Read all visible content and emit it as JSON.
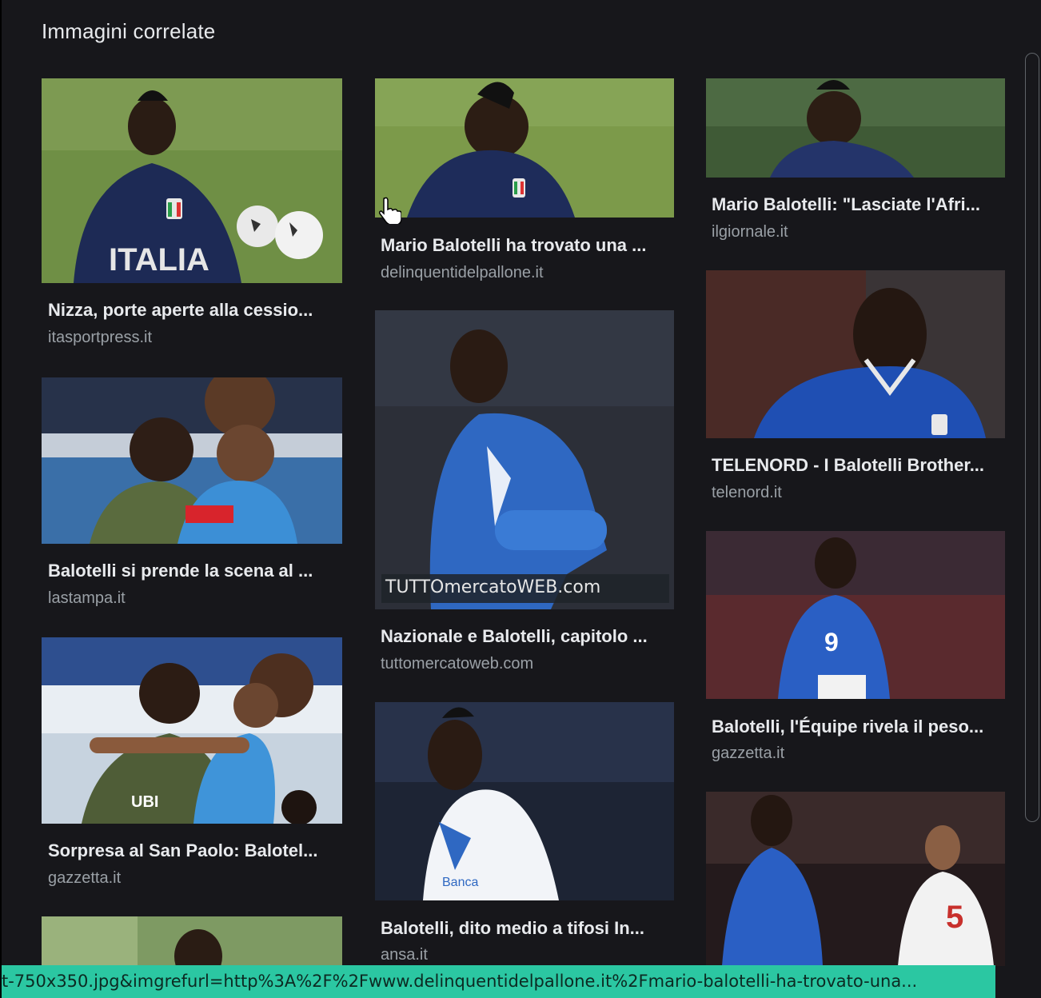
{
  "heading": "Immagini correlate",
  "colors": {
    "background": "#17171b",
    "title_text": "#e8eaed",
    "source_text": "#9aa0a6",
    "status_bar": "#2bc7a2"
  },
  "cards": [
    {
      "title": "Nizza, porte aperte alla cessio...",
      "source": "itasportpress.it"
    },
    {
      "title": "Balotelli si prende la scena al ...",
      "source": "lastampa.it"
    },
    {
      "title": "Sorpresa al San Paolo: Balotel...",
      "source": "gazzetta.it"
    },
    {
      "title": "Mario Balotelli ha trovato una ...",
      "source": "delinquentidelpallone.it"
    },
    {
      "title": "Nazionale e Balotelli, capitolo ...",
      "source": "tuttomercatoweb.com",
      "watermark": "TUTTOmercatoWEB.com"
    },
    {
      "title": "Balotelli, dito medio a tifosi In...",
      "source": "ansa.it"
    },
    {
      "title": "Mario Balotelli: \"Lasciate l'Afri...",
      "source": "ilgiornale.it"
    },
    {
      "title": "TELENORD - I Balotelli Brother...",
      "source": "telenord.it"
    },
    {
      "title": "Balotelli, l'Équipe rivela il peso...",
      "source": "gazzetta.it"
    }
  ],
  "status_url": "t-750x350.jpg&imgrefurl=http%3A%2F%2Fwww.delinquentidelpallone.it%2Fmario-balotelli-ha-trovato-una..."
}
